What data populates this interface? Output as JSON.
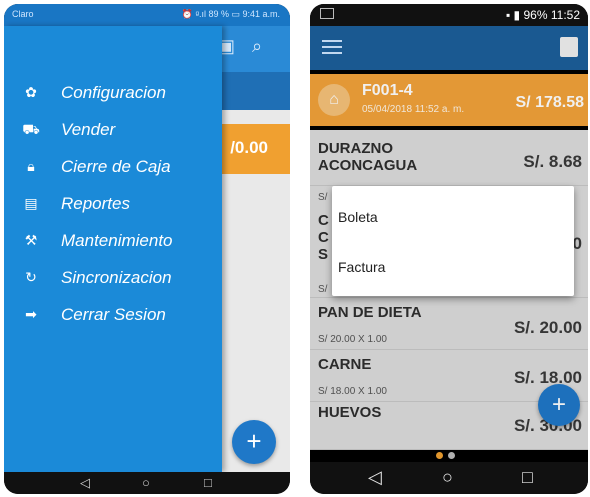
{
  "left_phone": {
    "status": {
      "carrier": "Claro",
      "indicators": "⏰ ᵍ.ıl 89 % ▭ 9:41 a.m."
    },
    "background": {
      "amount": "/0.00"
    },
    "drawer": {
      "items": [
        {
          "label": "Configuracion",
          "icon": "gear-icon"
        },
        {
          "label": "Vender",
          "icon": "cart-icon"
        },
        {
          "label": "Cierre de Caja",
          "icon": "lock-icon"
        },
        {
          "label": "Reportes",
          "icon": "clipboard-icon"
        },
        {
          "label": "Mantenimiento",
          "icon": "worker-icon"
        },
        {
          "label": "Sincronizacion",
          "icon": "sync-icon"
        },
        {
          "label": "Cerrar Sesion",
          "icon": "logout-icon"
        }
      ]
    },
    "fab": "+",
    "nav": {
      "back": "◁",
      "home": "○",
      "recent": "□"
    }
  },
  "right_phone": {
    "status": {
      "battery": "96%",
      "time": "11:52"
    },
    "invoice": {
      "code": "F001-4",
      "date": "05/04/2018 11:52 a. m.",
      "total": "S/ 178.58"
    },
    "products": [
      {
        "name": "DURAZNO ACONCAGUA",
        "detail": "S/",
        "price": "S/.   8.68"
      },
      {
        "name": "C C S",
        "detail": "S/",
        "price": "0"
      },
      {
        "name": "PAN DE DIETA",
        "detail": "S/ 20.00 X 1.00",
        "price": "S/.  20.00"
      },
      {
        "name": "CARNE",
        "detail": "S/ 18.00 X 1.00",
        "price": "S/.  18.00"
      },
      {
        "name": "HUEVOS",
        "detail": "",
        "price": "S/.  30.00"
      }
    ],
    "dialog": {
      "options": [
        "Boleta",
        "Factura"
      ]
    },
    "fab": "+",
    "nav": {
      "back": "◁",
      "home": "○",
      "recent": "□"
    }
  },
  "colors": {
    "drawer": "#1b8ad8",
    "accent_orange": "#f2a23a",
    "toolbar": "#1c5f9b",
    "fab": "#1f78c8"
  }
}
